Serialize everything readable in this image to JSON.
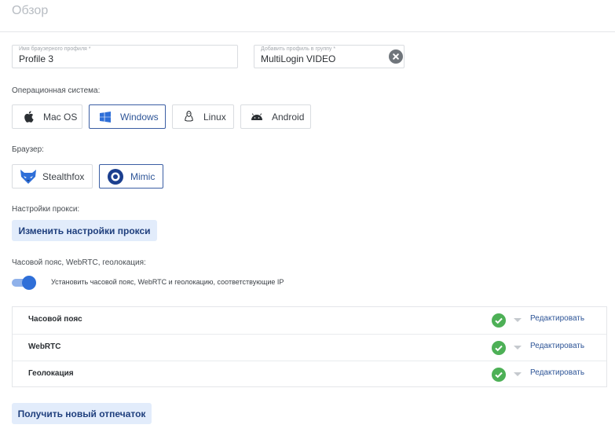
{
  "header": {
    "title": "Обзор"
  },
  "profile_name": {
    "label": "Имя браузерного профиля *",
    "value": "Profile 3"
  },
  "group": {
    "label": "Добавить профиль в группу *",
    "value": "MultiLogin VIDEO"
  },
  "os": {
    "label": "Операционная система:",
    "options": [
      {
        "label": "Mac OS",
        "icon": "apple-icon"
      },
      {
        "label": "Windows",
        "icon": "windows-icon"
      },
      {
        "label": "Linux",
        "icon": "linux-icon"
      },
      {
        "label": "Android",
        "icon": "android-icon"
      }
    ],
    "selected": "Windows"
  },
  "browser": {
    "label": "Браузер:",
    "options": [
      {
        "label": "Stealthfox",
        "icon": "stealthfox-icon"
      },
      {
        "label": "Mimic",
        "icon": "mimic-icon"
      }
    ],
    "selected": "Mimic"
  },
  "proxy": {
    "label": "Настройки прокси:",
    "button": "Изменить настройки прокси"
  },
  "timezone": {
    "label": "Часовой пояс, WebRTC, геолокация:",
    "toggle_text": "Установить часовой пояс, WebRTC и геолокацию, соответствующие IP",
    "toggle_on": true,
    "rows": [
      {
        "label": "Часовой пояс",
        "action": "Редактировать"
      },
      {
        "label": "WebRTC",
        "action": "Редактировать"
      },
      {
        "label": "Геолокация",
        "action": "Редактировать"
      }
    ]
  },
  "fingerprint_button": "Получить новый отпечаток",
  "colors": {
    "accent": "#2f6fd8",
    "button_bg": "#e2ecfb",
    "success": "#4db056"
  }
}
